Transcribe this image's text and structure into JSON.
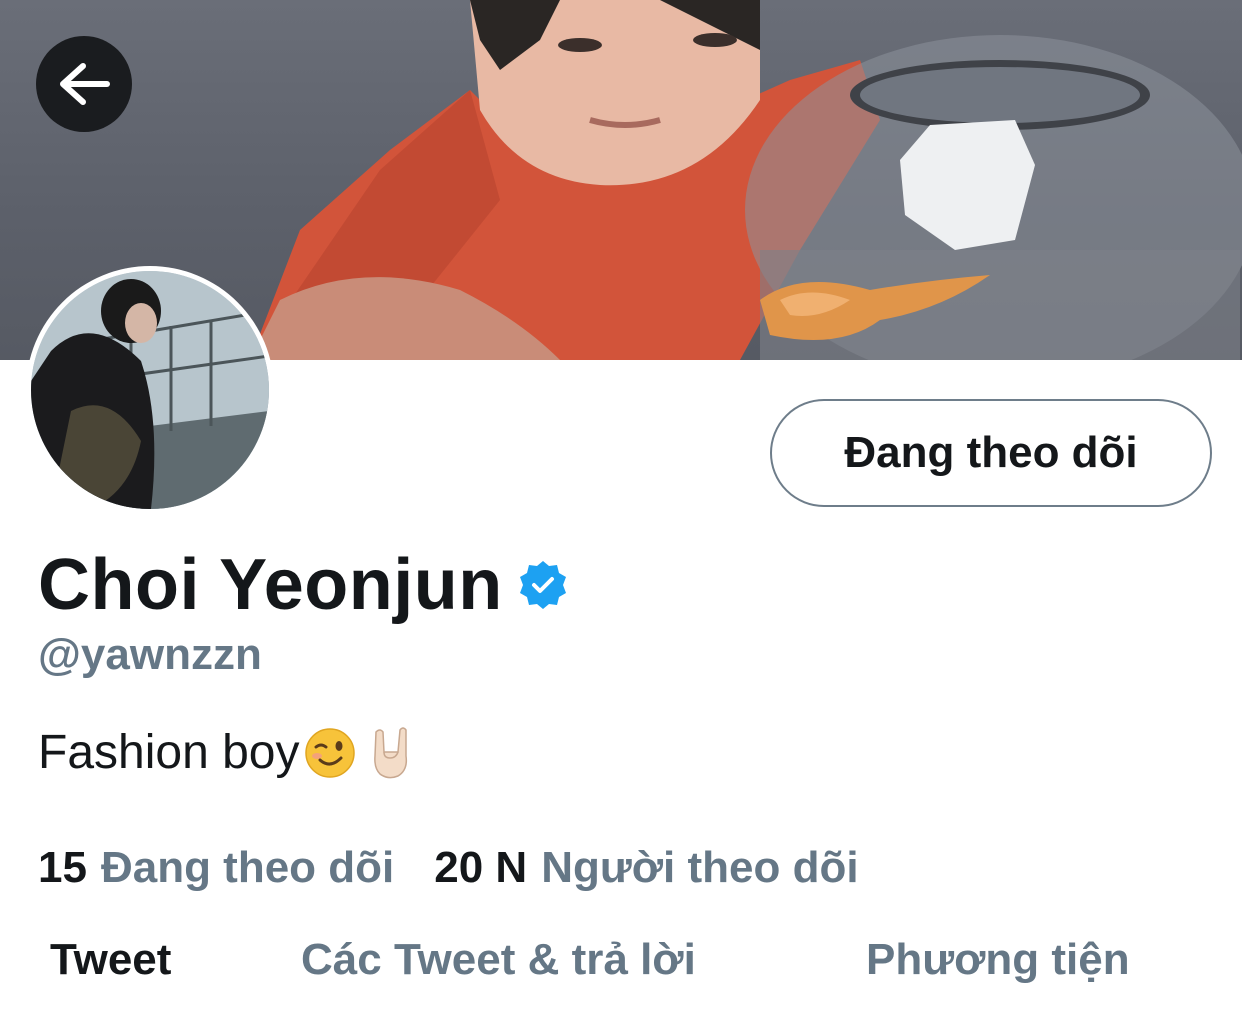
{
  "profile": {
    "name": "Choi Yeonjun",
    "handle": "@yawnzzn",
    "bio": "Fashion boy",
    "verified": true
  },
  "actions": {
    "follow_label": "Đang theo dõi"
  },
  "stats": {
    "following_count": "15",
    "following_label": "Đang theo dõi",
    "followers_count": "20 N",
    "followers_label": "Người theo dõi"
  },
  "tabs": [
    {
      "label": "Tweet",
      "active": true
    },
    {
      "label": "Các Tweet & trả lời",
      "active": false
    },
    {
      "label": "Phương tiện",
      "active": false
    }
  ],
  "colors": {
    "accent": "#1da1f2",
    "secondary_text": "#657786",
    "primary_text": "#14171a"
  },
  "icons": {
    "back": "arrow-left-icon",
    "verified": "verified-badge-icon",
    "bio_emoji_1": "winking-face-emoji",
    "bio_emoji_2": "sign-of-the-horns-emoji"
  }
}
